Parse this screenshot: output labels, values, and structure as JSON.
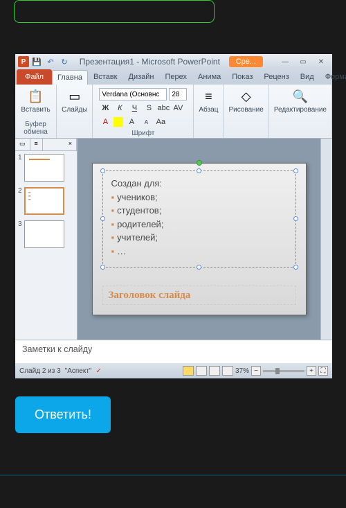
{
  "page": {
    "answer_button": "Ответить!"
  },
  "pp": {
    "title": "Презентация1 - Microsoft PowerPoint",
    "new_btn": "Сре...",
    "tabs": {
      "file": "Файл",
      "home": "Главна",
      "insert": "Вставк",
      "design": "Дизайн",
      "transitions": "Перех",
      "animations": "Анима",
      "slideshow": "Показ",
      "review": "Реценз",
      "view": "Вид",
      "format": "Формат"
    },
    "ribbon": {
      "clipboard": {
        "label": "Буфер обмена",
        "paste": "Вставить"
      },
      "slides": {
        "label": "Слайды"
      },
      "font": {
        "label": "Шрифт",
        "name": "Verdana (Основнс",
        "size": "28",
        "bold": "Ж",
        "italic": "К",
        "underline": "Ч",
        "strike": "S"
      },
      "paragraph": {
        "label": "Абзац"
      },
      "drawing": {
        "label": "Рисование"
      },
      "editing": {
        "label": "Редактирование"
      }
    },
    "slide": {
      "intro": "Создан для:",
      "items": [
        "учеников;",
        "студентов;",
        "родителей;",
        "учителей;",
        "…"
      ],
      "title_placeholder": "Заголовок слайда"
    },
    "notes": "Заметки к слайду",
    "status": {
      "slide_info": "Слайд 2 из 3",
      "theme": "\"Аспект\"",
      "zoom": "37%"
    }
  }
}
